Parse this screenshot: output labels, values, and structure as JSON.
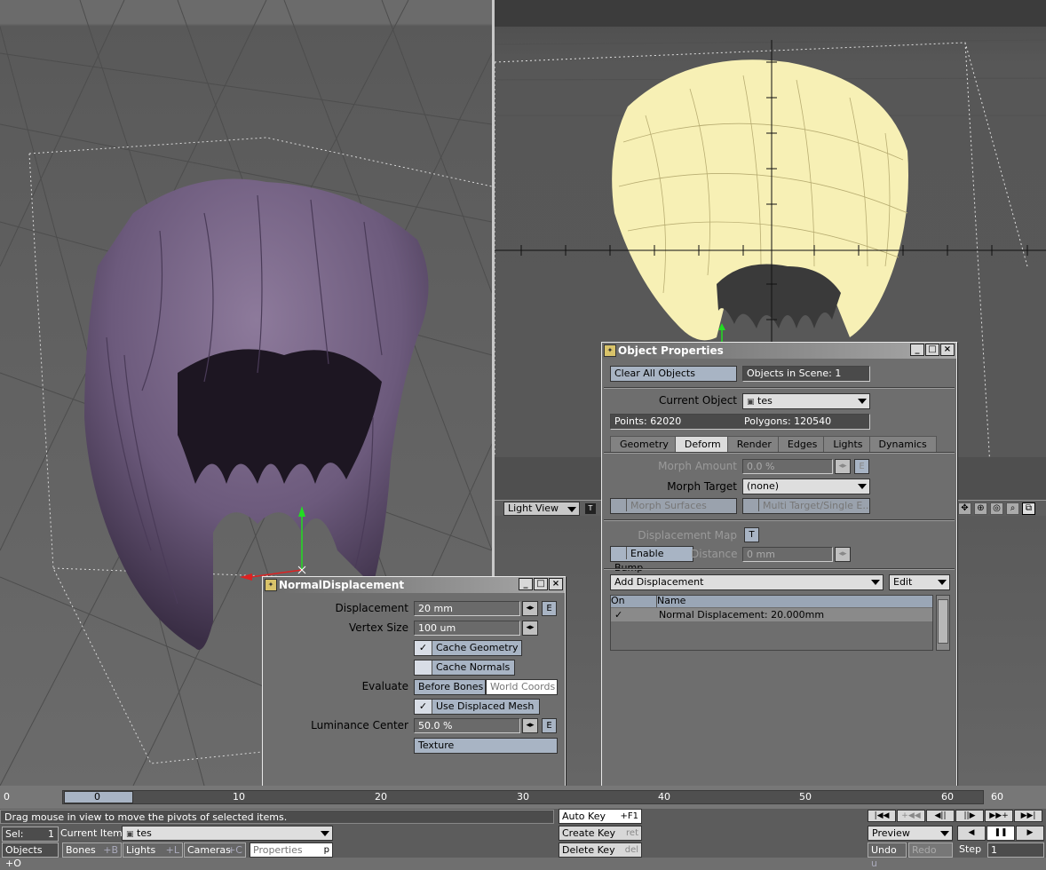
{
  "viewport_right": {
    "view_label": "Light View",
    "t_badge": "T"
  },
  "normal_displacement": {
    "title": "NormalDisplacement",
    "displacement_label": "Displacement",
    "displacement_value": "20 mm",
    "vertex_size_label": "Vertex Size",
    "vertex_size_value": "100 um",
    "cache_geometry": "Cache Geometry",
    "cache_normals": "Cache Normals",
    "evaluate_label": "Evaluate",
    "evaluate_a": "Before Bones",
    "evaluate_b": "World Coords",
    "use_displaced_mesh": "Use Displaced Mesh",
    "luminance_label": "Luminance Center",
    "luminance_value": "50.0 %",
    "texture": "Texture",
    "e": "E"
  },
  "object_properties": {
    "title": "Object Properties",
    "clear_all": "Clear All Objects",
    "objects_in_scene": "Objects in Scene: 1",
    "current_object_label": "Current Object",
    "current_object": "tes",
    "points": "Points: 62020",
    "polygons": "Polygons: 120540",
    "tabs": [
      "Geometry",
      "Deform",
      "Render",
      "Edges",
      "Lights",
      "Dynamics"
    ],
    "morph_amount_label": "Morph Amount",
    "morph_amount_value": "0.0 %",
    "morph_target_label": "Morph Target",
    "morph_target_value": "(none)",
    "morph_surfaces": "Morph Surfaces",
    "multi_target": "Multi Target/Single E...",
    "displacement_map_label": "Displacement Map",
    "t": "T",
    "enable_bump": "Enable Bump",
    "distance_label": "Distance",
    "distance_value": "0 mm",
    "add_displacement": "Add Displacement",
    "edit": "Edit",
    "col_on": "On",
    "col_name": "Name",
    "row_name": "Normal Displacement: 20.000mm",
    "row_check": "✓",
    "e": "E"
  },
  "timeline": {
    "start": "0",
    "current": "0",
    "ticks": [
      "10",
      "20",
      "30",
      "40",
      "50",
      "60"
    ],
    "end": "60"
  },
  "status": {
    "message": "Drag mouse in view to move the pivots of selected items.",
    "sel_label": "Sel:",
    "sel_value": "1",
    "current_item_label": "Current Item",
    "current_item": "tes",
    "objects": "Objects",
    "objects_key": "+O",
    "bones": "Bones",
    "bones_key": "+B",
    "lights": "Lights",
    "lights_key": "+L",
    "cameras": "Cameras",
    "cameras_key": "+C",
    "properties": "Properties",
    "properties_key": "p",
    "auto_key": "Auto Key",
    "auto_key_key": "+F1",
    "create_key": "Create Key",
    "create_key_key": "ret",
    "delete_key": "Delete Key",
    "delete_key_key": "del",
    "preview": "Preview",
    "undo": "Undo",
    "undo_key": "u",
    "redo": "Redo",
    "step_label": "Step",
    "step_value": "1"
  }
}
